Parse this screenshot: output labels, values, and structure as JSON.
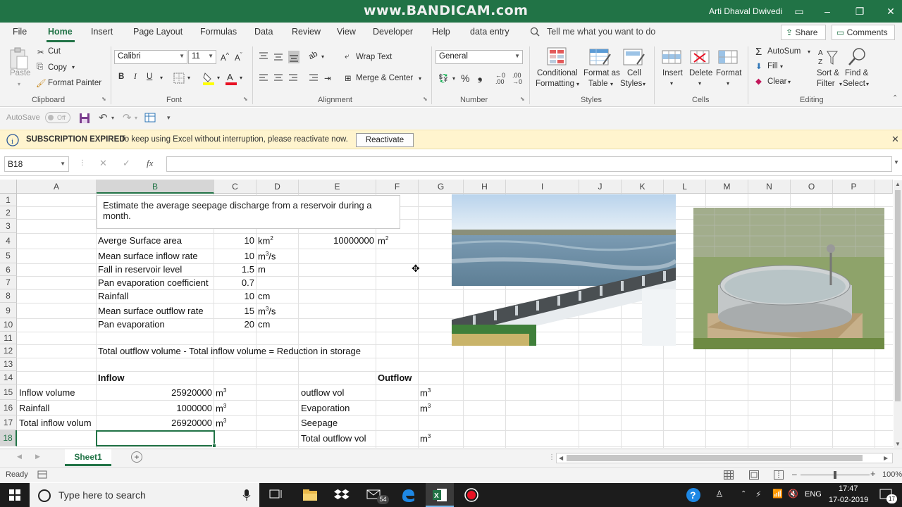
{
  "watermark": "www.BANDICAM.com",
  "user": "Arti Dhaval Dwivedi",
  "menu": {
    "items": [
      "File",
      "Home",
      "Insert",
      "Page Layout",
      "Formulas",
      "Data",
      "Review",
      "View",
      "Developer",
      "Help",
      "data entry"
    ],
    "active": "Home",
    "tell_me": "Tell me what you want to do",
    "share": "Share",
    "comments": "Comments"
  },
  "ribbon": {
    "clipboard": {
      "paste": "Paste",
      "cut": "Cut",
      "copy": "Copy",
      "format_painter": "Format Painter",
      "label": "Clipboard"
    },
    "font": {
      "name": "Calibri",
      "size": "11",
      "label": "Font"
    },
    "alignment": {
      "wrap": "Wrap Text",
      "merge": "Merge & Center",
      "label": "Alignment"
    },
    "number": {
      "format": "General",
      "label": "Number"
    },
    "styles": {
      "conditional": "Conditional",
      "conditional2": "Formatting",
      "format_table": "Format as",
      "format_table2": "Table",
      "cell_styles": "Cell",
      "cell_styles2": "Styles",
      "label": "Styles"
    },
    "cells": {
      "insert": "Insert",
      "delete": "Delete",
      "format": "Format",
      "label": "Cells"
    },
    "editing": {
      "autosum": "AutoSum",
      "fill": "Fill",
      "clear": "Clear",
      "sort": "Sort &",
      "sort2": "Filter",
      "find": "Find &",
      "find2": "Select",
      "label": "Editing"
    }
  },
  "qat": {
    "autosave": "AutoSave",
    "autosave_state": "Off"
  },
  "notice": {
    "title": "SUBSCRIPTION EXPIRED",
    "text": "To keep using Excel without interruption, please reactivate now.",
    "button": "Reactivate"
  },
  "formula_bar": {
    "name_box": "B18",
    "fx": "fx",
    "value": ""
  },
  "columns": [
    "A",
    "B",
    "C",
    "D",
    "E",
    "F",
    "G",
    "H",
    "I",
    "J",
    "K",
    "L",
    "M",
    "N",
    "O",
    "P"
  ],
  "rows": [
    "1",
    "2",
    "3",
    "4",
    "5",
    "6",
    "7",
    "8",
    "9",
    "10",
    "11",
    "12",
    "13",
    "14",
    "15",
    "16",
    "17",
    "18"
  ],
  "textbox": "Estimate the average seepage discharge from a reservoir during a month.",
  "cells": {
    "b4": "Averge Surface area",
    "c4": "10",
    "d4": "km",
    "d4sup": "2",
    "e4": "10000000",
    "f4": "m",
    "f4sup": "2",
    "b5": "Mean surface inflow rate",
    "c5": "10",
    "d5": "m",
    "d5sup": "3",
    "d5tail": "/s",
    "b6": "Fall in reservoir level",
    "c6": "1.5",
    "d6": "m",
    "b7": "Pan evaporation coefficient",
    "c7": "0.7",
    "b8": "Rainfall",
    "c8": "10",
    "d8": "cm",
    "b9": "Mean surface outflow rate",
    "c9": "15",
    "d9": "m",
    "d9sup": "3",
    "d9tail": "/s",
    "b10": "Pan evaporation",
    "c10": "20",
    "d10": "cm",
    "b12": "Total outflow volume - Total inflow volume = Reduction in storage",
    "b14": "Inflow",
    "f14": "Outflow",
    "a15": "Inflow volume",
    "b15": "25920000",
    "c15": "m",
    "c15sup": "3",
    "e15": "outflow vol",
    "g15": "m",
    "g15sup": "3",
    "a16": "Rainfall",
    "b16": "1000000",
    "c16": "m",
    "c16sup": "3",
    "e16": "Evaporation",
    "g16": "m",
    "g16sup": "3",
    "a17": "Total inflow volum",
    "b17": "26920000",
    "c17": "m",
    "c17sup": "3",
    "e17": "Seepage",
    "e18": "Total outflow vol",
    "g18": "m",
    "g18sup": "3"
  },
  "sheet_tab": "Sheet1",
  "status": {
    "ready": "Ready",
    "zoom": "100%"
  },
  "taskbar": {
    "search": "Type here to search",
    "time": "17:47",
    "date": "17-02-2019",
    "lang": "ENG",
    "mail_badge": "54",
    "notif": "17"
  },
  "colors": {
    "excel_green": "#217346",
    "notice_bg": "#fff4ce"
  }
}
